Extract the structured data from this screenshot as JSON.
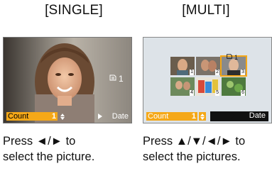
{
  "headers": {
    "single": "[SINGLE]",
    "multi": "[MULTI]"
  },
  "single_screen": {
    "count_label": "Count",
    "count_value": "1",
    "date_label": "Date",
    "protect_icon": "print-icon",
    "icon_count": "1"
  },
  "multi_screen": {
    "count_label": "Count",
    "count_value": "1",
    "date_label": "Date",
    "icon_count": "1",
    "thumb_numbers": [
      "1",
      "2",
      "3",
      "4",
      "5",
      "6"
    ],
    "selected_thumb": "3"
  },
  "captions": {
    "single_line1": "Press ◄/► to",
    "single_line2": "select the picture.",
    "multi_line1": "Press ▲/▼/◄/► to",
    "multi_line2": "select the pictures."
  },
  "colors": {
    "accent": "#f5a818",
    "panel_bg": "#dde3e8"
  }
}
